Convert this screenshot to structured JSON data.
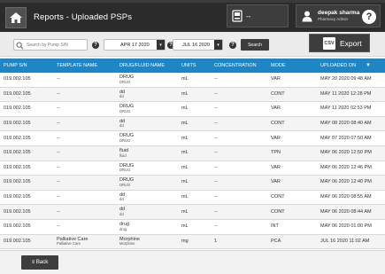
{
  "header": {
    "title": "Reports - Uploaded PSPs",
    "pump_label": "--",
    "user_name": "deepak sharma",
    "user_role": "Pharmacy Admin",
    "help_label": "?"
  },
  "filters": {
    "search_placeholder": "Search by Pump S/N",
    "start_date": "APR 17 2020",
    "end_date": "JUL 16 2020",
    "search_button": "Search",
    "export_icon_text": "CSV",
    "export_label": "Export"
  },
  "table": {
    "columns": [
      "PUMP S/N",
      "TEMPLATE NAME",
      "DRUG/FLUID NAME",
      "UNITS",
      "CONCENTRATION",
      "MODE",
      "UPLOADED ON"
    ],
    "rows": [
      {
        "sn": "019.002.105",
        "template": "--",
        "template_sub": "",
        "drug": "DRUG",
        "drug_sub": "DRUG",
        "units": "mL",
        "conc": "--",
        "mode": "VAR",
        "uploaded": "MAY 20 2020 09:48 AM"
      },
      {
        "sn": "019.002.105",
        "template": "--",
        "template_sub": "",
        "drug": "dd",
        "drug_sub": "dd",
        "units": "mL",
        "conc": "--",
        "mode": "CONT",
        "uploaded": "MAY 11 2020 12:28 PM"
      },
      {
        "sn": "019.002.105",
        "template": "--",
        "template_sub": "",
        "drug": "DRUG",
        "drug_sub": "DRUG",
        "units": "mL",
        "conc": "--",
        "mode": "VAR",
        "uploaded": "MAY 11 2020 02:53 PM"
      },
      {
        "sn": "019.002.105",
        "template": "--",
        "template_sub": "",
        "drug": "dd",
        "drug_sub": "dd",
        "units": "mL",
        "conc": "--",
        "mode": "CONT",
        "uploaded": "MAY 08 2020 08:40 AM"
      },
      {
        "sn": "019.002.105",
        "template": "--",
        "template_sub": "",
        "drug": "DRUG",
        "drug_sub": "DRUG",
        "units": "mL",
        "conc": "--",
        "mode": "VAR",
        "uploaded": "MAY 07 2020 07:50 AM"
      },
      {
        "sn": "019.002.105",
        "template": "--",
        "template_sub": "",
        "drug": "fluid",
        "drug_sub": "fluid",
        "units": "mL",
        "conc": "--",
        "mode": "TPN",
        "uploaded": "MAY 06 2020 12:50 PM"
      },
      {
        "sn": "019.002.105",
        "template": "--",
        "template_sub": "",
        "drug": "DRUG",
        "drug_sub": "DRUG",
        "units": "mL",
        "conc": "--",
        "mode": "VAR",
        "uploaded": "MAY 06 2020 12:46 PM"
      },
      {
        "sn": "019.002.105",
        "template": "--",
        "template_sub": "",
        "drug": "DRUG",
        "drug_sub": "DRUG",
        "units": "mL",
        "conc": "--",
        "mode": "VAR",
        "uploaded": "MAY 06 2020 12:40 PM"
      },
      {
        "sn": "019.002.105",
        "template": "--",
        "template_sub": "",
        "drug": "dd",
        "drug_sub": "dd",
        "units": "mL",
        "conc": "--",
        "mode": "CONT",
        "uploaded": "MAY 06 2020 08:55 AM"
      },
      {
        "sn": "019.002.105",
        "template": "--",
        "template_sub": "",
        "drug": "dd",
        "drug_sub": "dd",
        "units": "mL",
        "conc": "--",
        "mode": "CONT",
        "uploaded": "MAY 06 2020 08:44 AM"
      },
      {
        "sn": "019.002.105",
        "template": "--",
        "template_sub": "",
        "drug": "drug",
        "drug_sub": "drug",
        "units": "mL",
        "conc": "--",
        "mode": "INT",
        "uploaded": "MAY 06 2020 01:00 PM"
      },
      {
        "sn": "019.002.105",
        "template": "Palliative Care",
        "template_sub": "Palliative Care",
        "drug": "Morphine",
        "drug_sub": "Morphine",
        "units": "mg",
        "conc": "1",
        "mode": "PCA",
        "uploaded": "JUL 16 2020 11:02 AM"
      }
    ]
  },
  "footer": {
    "back_label": "≡ Back"
  },
  "colors": {
    "header_bg": "#2b2b2b",
    "table_header_bg": "#1e86c4",
    "button_bg": "#3d3d3d"
  }
}
